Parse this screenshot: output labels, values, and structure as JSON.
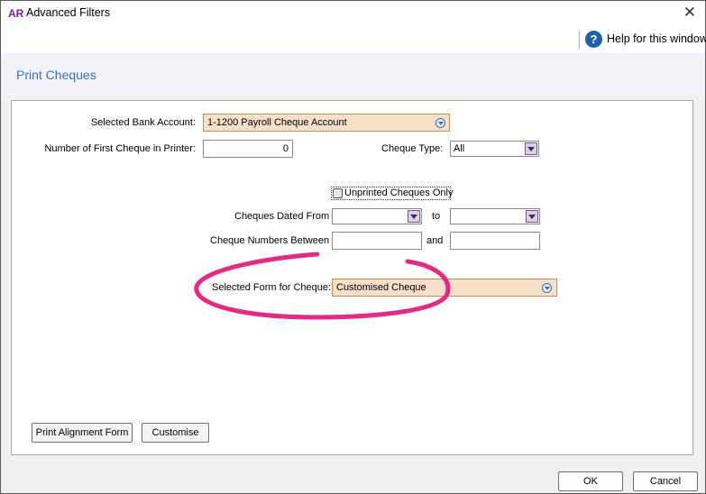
{
  "window": {
    "app_logo": "AR",
    "title": "Advanced Filters",
    "close_glyph": "✕"
  },
  "help": {
    "icon_glyph": "?",
    "label": "Help for this window"
  },
  "page": {
    "title": "Print Cheques"
  },
  "form": {
    "bank_account": {
      "label": "Selected Bank Account:",
      "value": "1-1200 Payroll Cheque Account"
    },
    "first_cheque": {
      "label": "Number of First Cheque in Printer:",
      "value": "0"
    },
    "cheque_type": {
      "label": "Cheque Type:",
      "value": "All"
    },
    "unprinted_only": {
      "label": "Unprinted Cheques Only",
      "checked": false
    },
    "dated_from": {
      "label": "Cheques Dated From",
      "from_value": "",
      "to_label": "to",
      "to_value": ""
    },
    "numbers_between": {
      "label": "Cheque Numbers Between",
      "from_value": "",
      "and_label": "and",
      "to_value": ""
    },
    "form_for_cheque": {
      "label": "Selected Form for Cheque:",
      "value": "Customised Cheque"
    }
  },
  "buttons": {
    "print_alignment": "Print Alignment Form",
    "customise": "Customise",
    "ok": "OK",
    "cancel": "Cancel"
  },
  "annotation": {
    "color": "#e0197a"
  }
}
